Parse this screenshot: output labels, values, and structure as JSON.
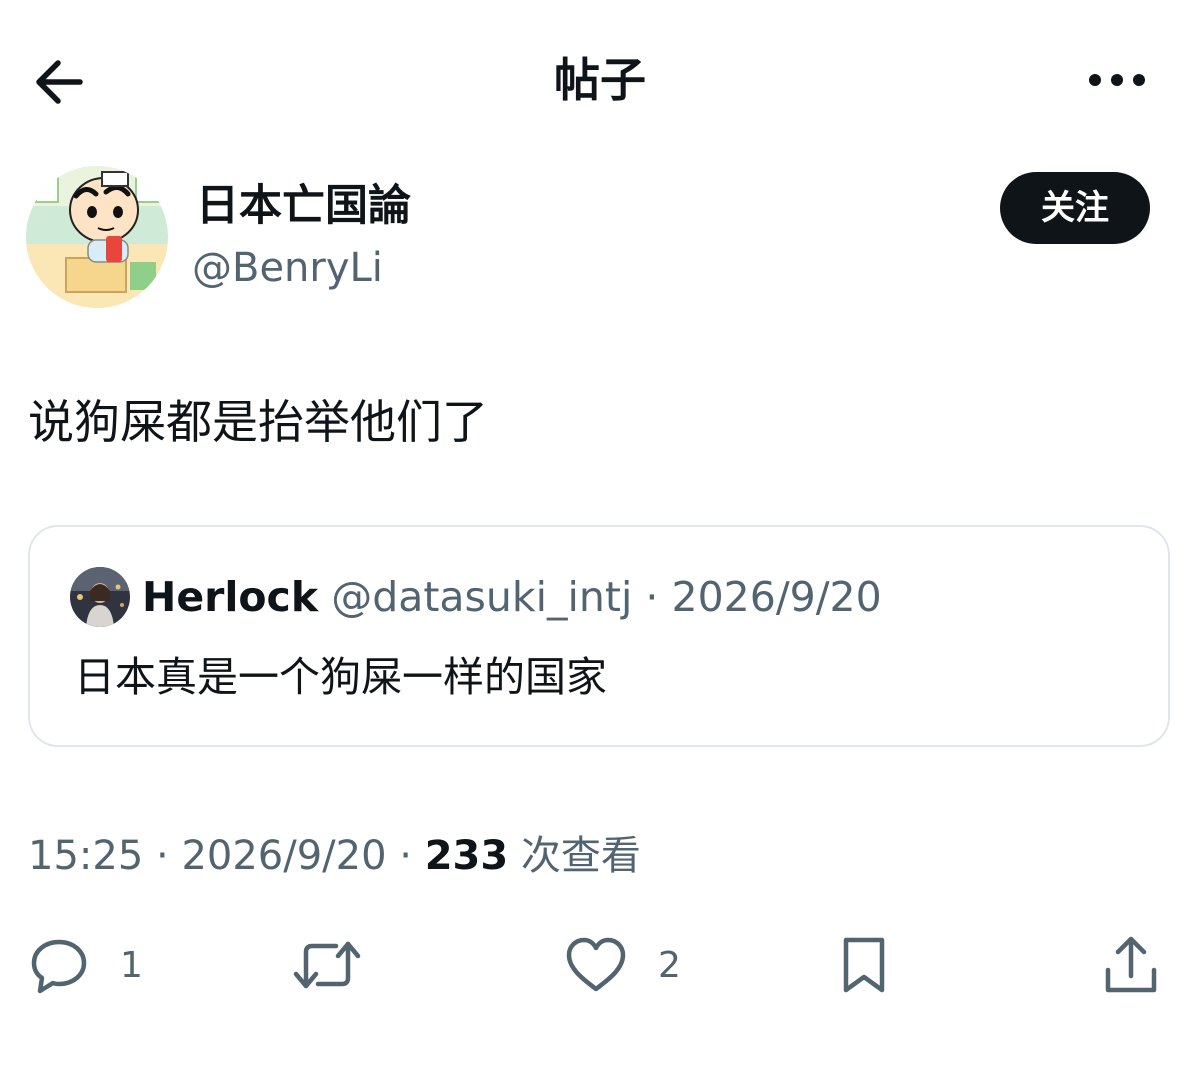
{
  "header": {
    "title": "帖子",
    "back_icon": "arrow-left-icon",
    "more_icon": "more-horizontal-icon"
  },
  "author": {
    "display_name": "日本亡国論",
    "handle": "@BenryLi",
    "follow_label": "关注"
  },
  "post": {
    "text": "说狗屎都是抬举他们了"
  },
  "quoted": {
    "name": "Herlock",
    "handle": "@datasuki_intj",
    "separator": " · ",
    "date": "2026/9/20",
    "text": "日本真是一个狗屎一样的国家"
  },
  "meta": {
    "time": "15:25",
    "separator": " · ",
    "date": "2026/9/20",
    "views_count": "233",
    "views_label": "次查看"
  },
  "actions": {
    "reply_count": "1",
    "repost_count": "",
    "like_count": "2",
    "icons": [
      "reply-icon",
      "repost-icon",
      "like-icon",
      "bookmark-icon",
      "share-icon"
    ]
  },
  "colors": {
    "text_primary": "#0f1419",
    "text_secondary": "#536471",
    "border": "#e1e6ea",
    "follow_bg": "#0f1419"
  }
}
